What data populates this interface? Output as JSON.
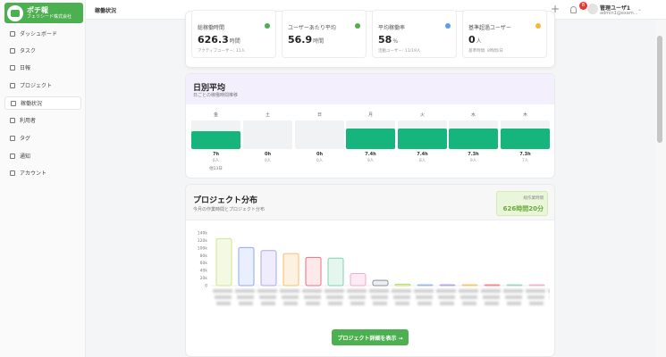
{
  "brand": {
    "title": "ポチ報",
    "company": "フェリシード株式会社"
  },
  "sidebar": {
    "items": [
      {
        "label": "ダッシュボード",
        "icon": "home-icon",
        "active": false
      },
      {
        "label": "タスク",
        "icon": "list-icon",
        "active": false
      },
      {
        "label": "日報",
        "icon": "calendar-icon",
        "active": false
      },
      {
        "label": "プロジェクト",
        "icon": "folder-icon",
        "active": false
      },
      {
        "label": "稼働状況",
        "icon": "chart-icon",
        "active": true
      },
      {
        "label": "利用者",
        "icon": "users-icon",
        "active": false
      },
      {
        "label": "タグ",
        "icon": "tag-icon",
        "active": false
      },
      {
        "label": "通知",
        "icon": "bell-icon",
        "active": false
      },
      {
        "label": "アカウント",
        "icon": "account-icon",
        "active": false
      }
    ]
  },
  "header": {
    "title": "稼働状況",
    "notification_count": "8",
    "user_name": "管理ユーザ1",
    "user_email": "admin1@exam..."
  },
  "stats": [
    {
      "label": "総稼働時間",
      "value": "626.3",
      "unit": "時間",
      "sub": "アクティブユーザー: 11人",
      "color": "#4caf50"
    },
    {
      "label": "ユーザーあたり平均",
      "value": "56.9",
      "unit": "時間",
      "sub": "",
      "color": "#4caf50"
    },
    {
      "label": "平均稼働率",
      "value": "58",
      "unit": "%",
      "sub": "活動ユーザー: 11/19人",
      "color": "#5c9ded"
    },
    {
      "label": "基準超過ユーザー",
      "value": "0",
      "unit": "人",
      "sub": "基準時間: 8時間/日",
      "color": "#f5b93a"
    }
  ],
  "daily": {
    "title": "日別平均",
    "subtitle": "日ごとの稼働時間推移",
    "days": [
      {
        "day": "金",
        "hours": "7h",
        "users": "6人",
        "fill": 0.62,
        "date": "他13日"
      },
      {
        "day": "土",
        "hours": "0h",
        "users": "0人",
        "fill": 0,
        "date": ""
      },
      {
        "day": "日",
        "hours": "0h",
        "users": "0人",
        "fill": 0,
        "date": ""
      },
      {
        "day": "月",
        "hours": "7.4h",
        "users": "9人",
        "fill": 0.72,
        "date": ""
      },
      {
        "day": "火",
        "hours": "7.4h",
        "users": "8人",
        "fill": 0.72,
        "date": ""
      },
      {
        "day": "水",
        "hours": "7.3h",
        "users": "9人",
        "fill": 0.72,
        "date": ""
      },
      {
        "day": "木",
        "hours": "7.3h",
        "users": "7人",
        "fill": 0.72,
        "date": ""
      }
    ]
  },
  "distribution": {
    "title": "プロジェクト分布",
    "subtitle": "今月の作業時間とプロジェクト分布",
    "total_label": "総作業時間",
    "total_value": "626時間20分",
    "button_label": "プロジェクト詳細を表示 →"
  },
  "chart_data": {
    "type": "bar",
    "ylim": [
      0,
      140000
    ],
    "yticks": [
      "140k",
      "120k",
      "100k",
      "80k",
      "60k",
      "40k",
      "20k",
      "0"
    ],
    "values": [
      125000,
      101000,
      93000,
      85000,
      75000,
      73000,
      32000,
      14000,
      4000,
      2000,
      1500,
      1000,
      1000,
      500,
      500,
      300
    ],
    "colors": [
      "#cfe68a",
      "#8ea9ec",
      "#b5a6e8",
      "#f5bf6a",
      "#ee6f7a",
      "#7fd3ae",
      "#f3a9cf",
      "#8a8f98",
      "#b8dc6a",
      "#9db8e8",
      "#b7a6e4",
      "#f4c57a",
      "#ef8b8b",
      "#9fd9bd",
      "#f1b5d2",
      "#b7b7b7"
    ],
    "fills": [
      "#f4f9e3",
      "#e9effc",
      "#efecfb",
      "#fdf2e1",
      "#fde8ea",
      "#e5f6ee",
      "#fdebf4",
      "#eceef1",
      "#f1f8e0",
      "#ebf1fb",
      "#f0ecfb",
      "#fdf3e4",
      "#fceaea",
      "#e9f7f0",
      "#fcecf4",
      "#f1f1f1"
    ]
  }
}
